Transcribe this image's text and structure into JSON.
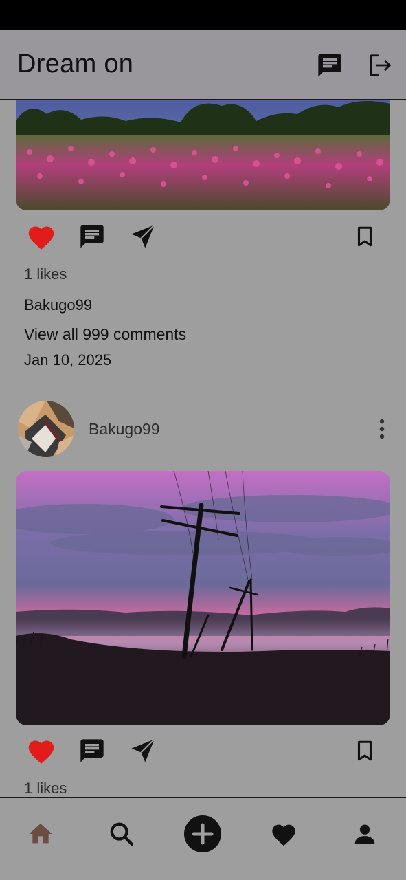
{
  "app": {
    "title": "Dream on"
  },
  "header": {
    "messages_icon": "chat-icon",
    "logout_icon": "logout-icon"
  },
  "posts": [
    {
      "likes": "1 likes",
      "username": "Bakugo99",
      "comments": "View all 999 comments",
      "date": "Jan 10, 2025",
      "liked": true
    },
    {
      "username": "Bakugo99",
      "likes": "1 likes",
      "liked": true
    }
  ],
  "nav": {
    "items": [
      "home-icon",
      "search-icon",
      "add-icon",
      "favorites-icon",
      "profile-icon"
    ],
    "active": "home",
    "active_color": "#6d4c41"
  },
  "colors": {
    "like": "#e21b1b",
    "text": "#111111"
  }
}
